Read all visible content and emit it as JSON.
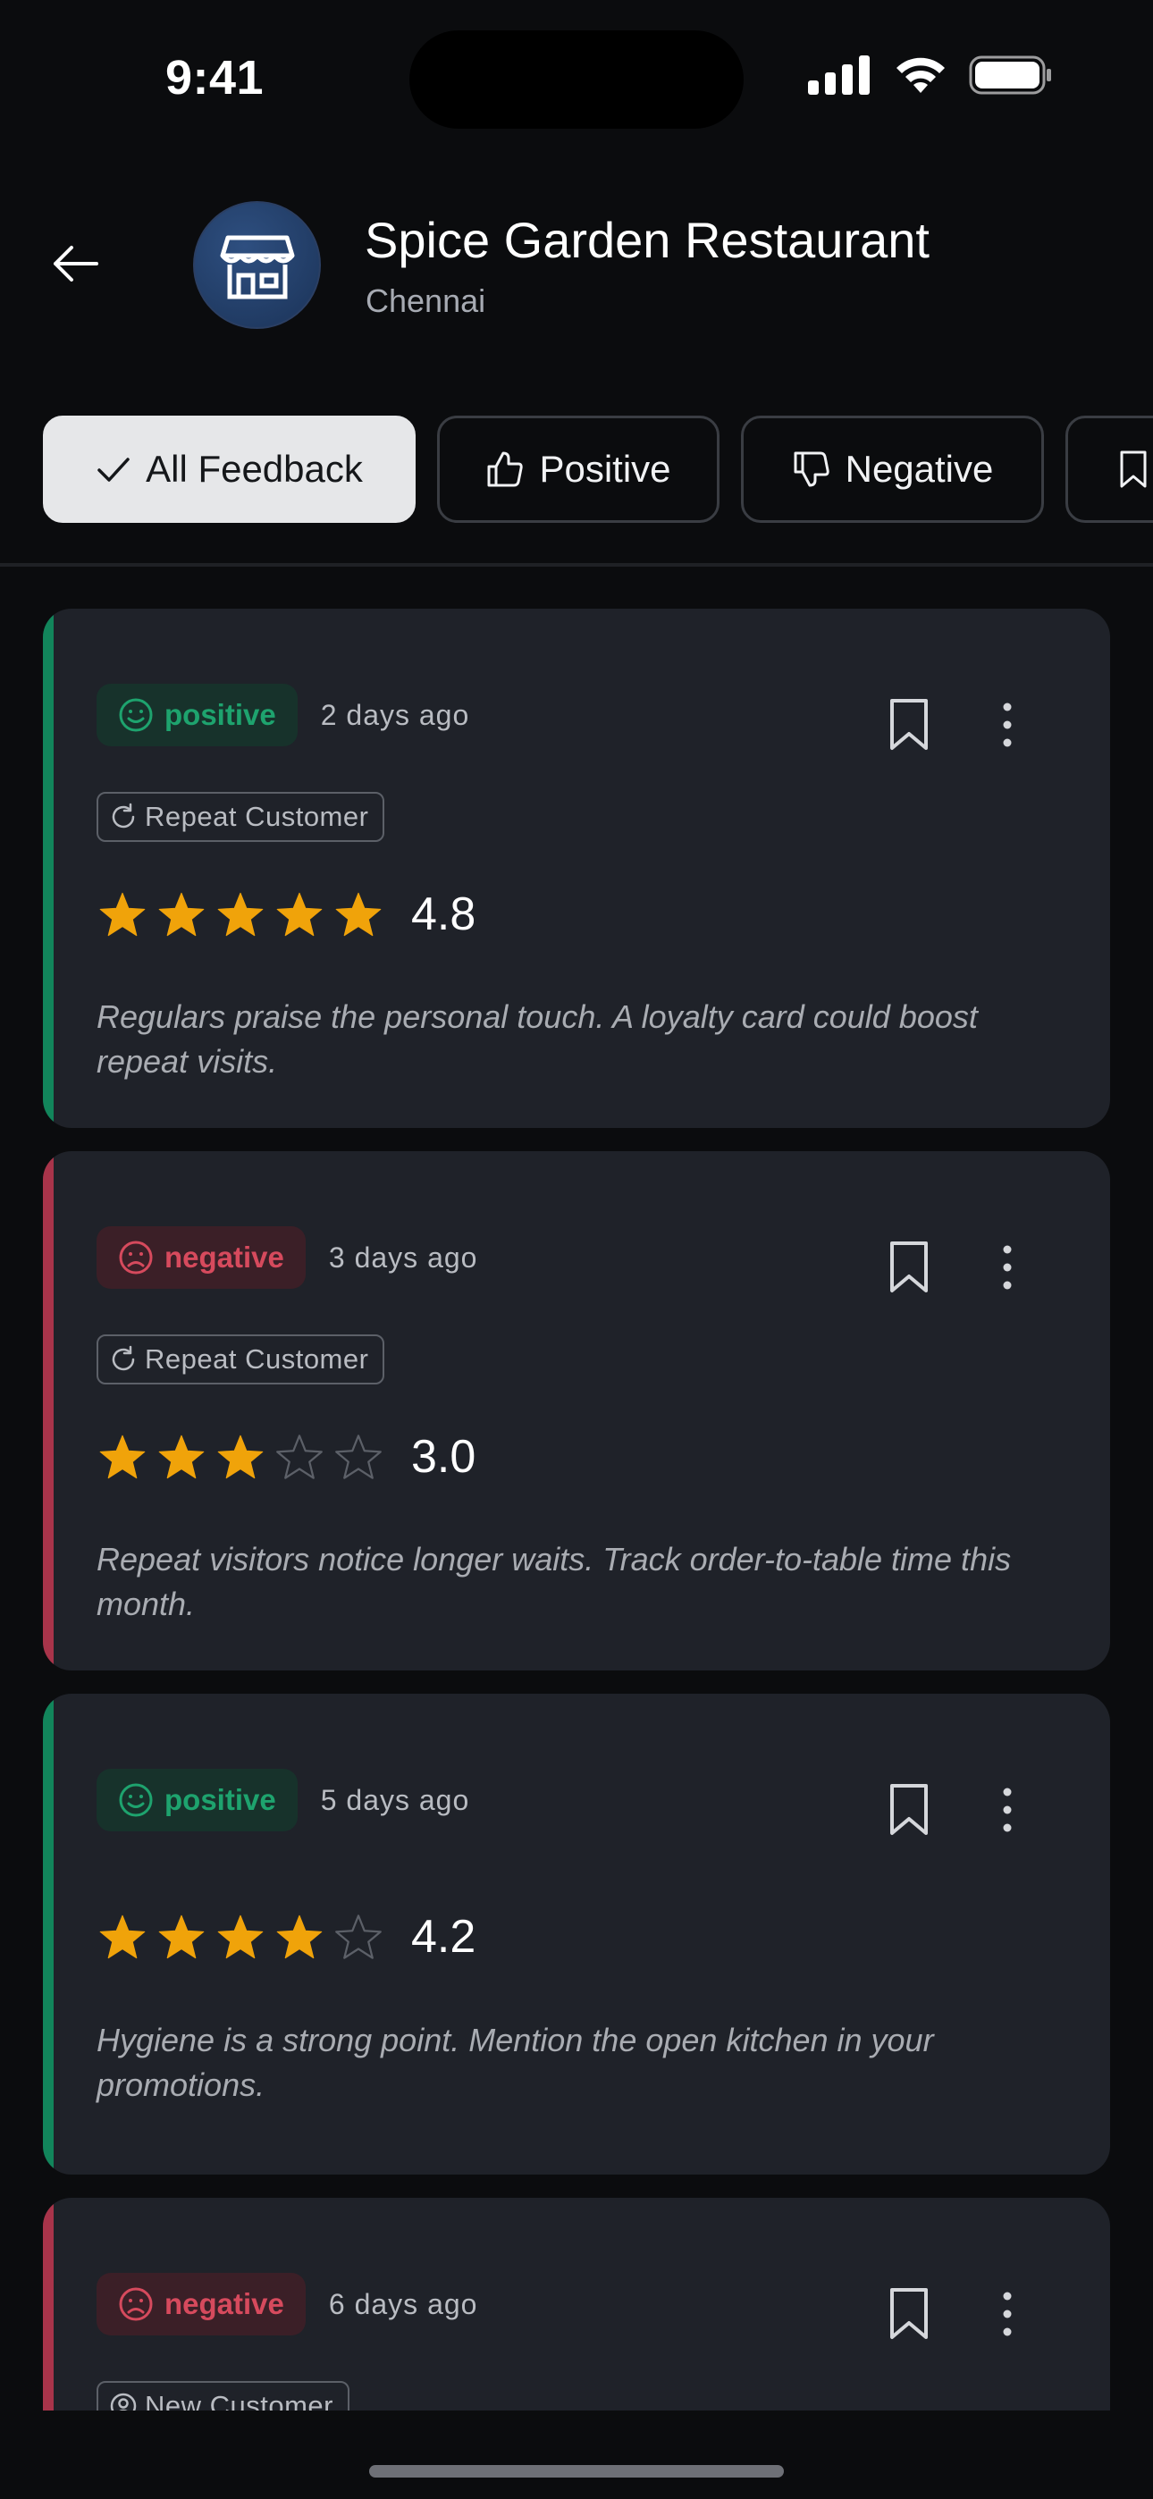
{
  "status_bar": {
    "time": "9:41"
  },
  "header": {
    "title": "Spice Garden Restaurant",
    "subtitle": "Chennai"
  },
  "filters": [
    {
      "label": "All Feedback",
      "active": true,
      "icon": "check-icon"
    },
    {
      "label": "Positive",
      "active": false,
      "icon": "thumbs-up-icon"
    },
    {
      "label": "Negative",
      "active": false,
      "icon": "thumbs-down-icon"
    },
    {
      "label": "",
      "active": false,
      "icon": "bookmark-icon"
    }
  ],
  "feedback": [
    {
      "sentiment": "positive",
      "time_ago": "2 days ago",
      "tag": "Repeat Customer",
      "tag_icon": "refresh-icon",
      "stars_filled": 5,
      "rating": "4.8",
      "comment": "Regulars praise the personal touch. A loyalty card could boost repeat visits."
    },
    {
      "sentiment": "negative",
      "time_ago": "3 days ago",
      "tag": "Repeat Customer",
      "tag_icon": "refresh-icon",
      "stars_filled": 3,
      "rating": "3.0",
      "comment": "Repeat visitors notice longer waits. Track order-to-table time this month."
    },
    {
      "sentiment": "positive",
      "time_ago": "5 days ago",
      "tag": "",
      "stars_filled": 4,
      "rating": "4.2",
      "comment": "Hygiene is a strong point. Mention the open kitchen in your promotions."
    },
    {
      "sentiment": "negative",
      "time_ago": "6 days ago",
      "tag": "New Customer",
      "tag_icon": "user-icon",
      "stars_filled": 0,
      "rating": "",
      "comment": ""
    }
  ],
  "colors": {
    "positive": "#12855b",
    "negative": "#a8344a",
    "star": "#f0a30a",
    "card": "#1f2229"
  }
}
